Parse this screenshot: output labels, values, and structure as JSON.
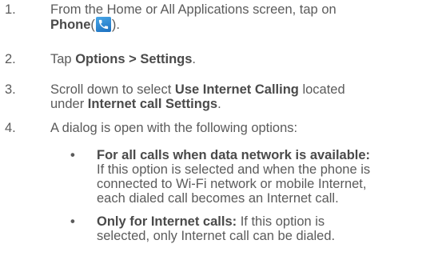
{
  "steps": [
    {
      "number": "1.",
      "text_before": "From the Home or All Applications screen, tap on",
      "bold": "Phone",
      "paren_open": "(",
      "icon": "phone-app-icon",
      "paren_close": ")."
    },
    {
      "number": "2.",
      "text_before": "Tap ",
      "bold": "Options > Settings",
      "text_after": "."
    },
    {
      "number": "3.",
      "line1_text": "Scroll down to select ",
      "line1_bold": "Use Internet Calling",
      "line1_after": " located",
      "line2_text": "under ",
      "line2_bold": "Internet call Settings",
      "line2_after": "."
    },
    {
      "number": "4.",
      "text": "A dialog is open with the following options:"
    }
  ],
  "bullets": [
    {
      "dot": "•",
      "bold": "For all calls when data network is available:",
      "lines": [
        "If this option is selected and when the phone is",
        "connected to Wi-Fi network or mobile Internet,",
        "each dialed call becomes an Internet call."
      ]
    },
    {
      "dot": "•",
      "bold": "Only for Internet calls:",
      "line1_after": " If this option is",
      "line2": "selected, only Internet call can be dialed."
    }
  ]
}
